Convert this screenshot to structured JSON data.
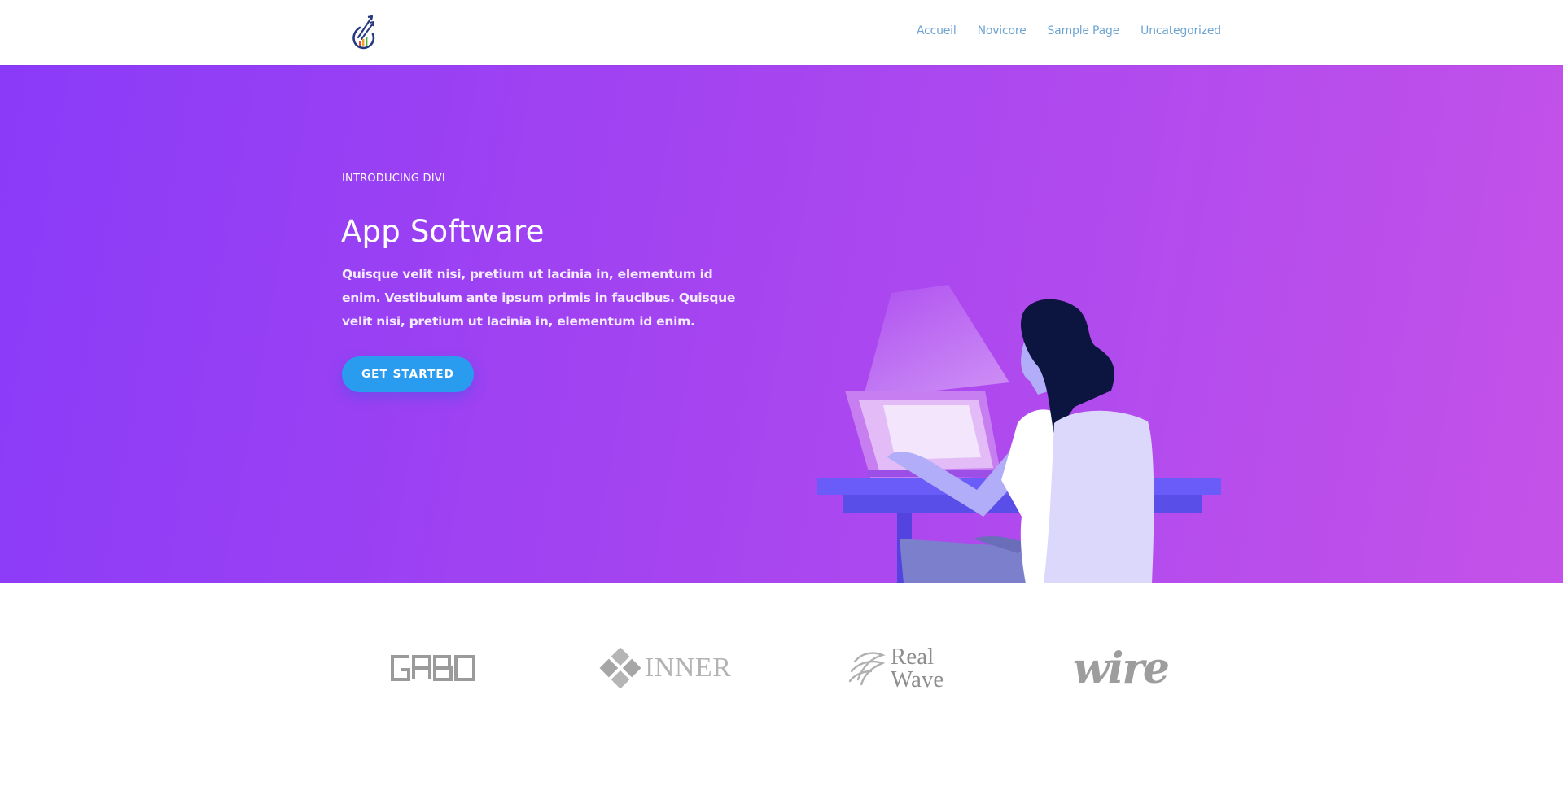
{
  "header": {
    "logo_icon": "growth-chart-drop-logo",
    "nav": [
      {
        "label": "Accueil"
      },
      {
        "label": "Novicore"
      },
      {
        "label": "Sample Page"
      },
      {
        "label": "Uncategorized"
      }
    ],
    "nav_color": "#6ea4d1"
  },
  "hero": {
    "eyebrow": "INTRODUCING DIVI",
    "title": "App Software",
    "body": "Quisque velit nisi, pretium ut lacinia in, elementum id enim. Vestibulum ante ipsum primis in faucibus. Quisque velit nisi, pretium ut lacinia in, elementum id enim.",
    "cta_label": "GET STARTED",
    "gradient_start": "#8a3bf8",
    "gradient_end": "#c452e8",
    "cta_color": "#2a9cf0",
    "illustration": "woman-at-laptop-illustration"
  },
  "partners": [
    {
      "name": "GABO"
    },
    {
      "name": "INNER"
    },
    {
      "name_line1": "Real",
      "name_line2": "Wave"
    },
    {
      "name": "wire"
    }
  ]
}
